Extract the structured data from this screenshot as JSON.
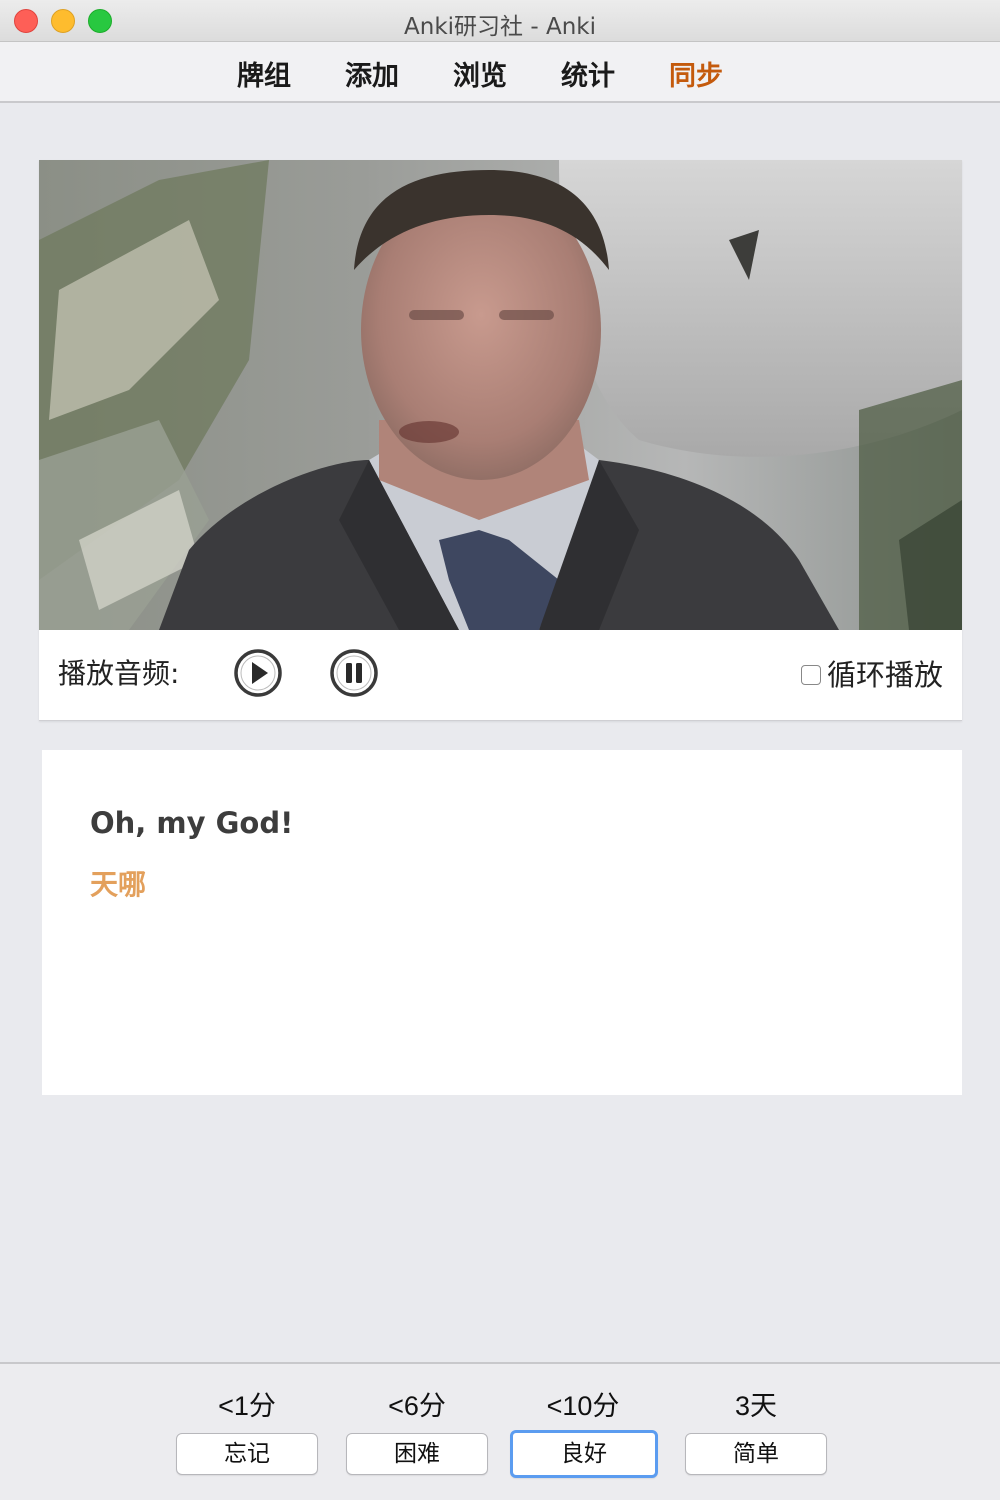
{
  "window": {
    "title": "Anki研习社 - Anki"
  },
  "toolbar": {
    "items": [
      {
        "label": "牌组"
      },
      {
        "label": "添加"
      },
      {
        "label": "浏览"
      },
      {
        "label": "统计"
      },
      {
        "label": "同步"
      }
    ],
    "sync_color": "#c45a0c"
  },
  "media": {
    "audio_label": "播放音频:",
    "play_icon": "play-icon",
    "pause_icon": "pause-icon",
    "loop_label": "循环播放",
    "loop_checked": false
  },
  "card": {
    "english": "Oh, my God!",
    "chinese": "天哪",
    "chinese_color": "#e3a05c"
  },
  "answer_buttons": [
    {
      "interval": "<1分",
      "label": "忘记"
    },
    {
      "interval": "<6分",
      "label": "困难"
    },
    {
      "interval": "<10分",
      "label": "良好",
      "default": true
    },
    {
      "interval": "3天",
      "label": "简单"
    }
  ]
}
